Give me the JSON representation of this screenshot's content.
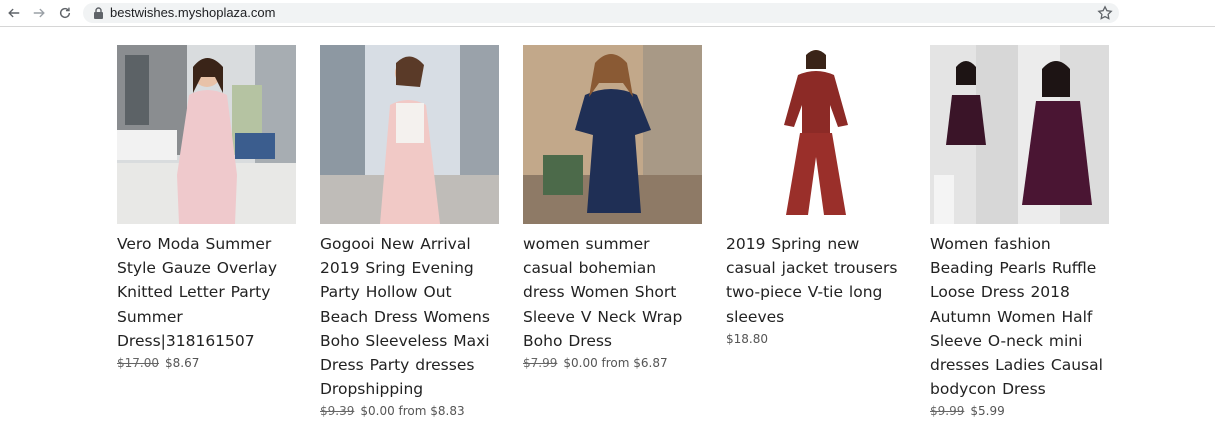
{
  "browser": {
    "url": "bestwishes.myshoplaza.com",
    "icons": [
      "back-arrow-icon",
      "forward-arrow-icon",
      "reload-icon",
      "lock-icon",
      "bookmark-star-icon"
    ]
  },
  "products": [
    {
      "title": "Vero Moda Summer Style Gauze Overlay Knitted Letter Party Summer Dress|318161507",
      "old_price": "$17.00",
      "price": "$8.67"
    },
    {
      "title": "Gogooi New Arrival 2019 Sring Evening Party Hollow Out Beach Dress Womens Boho Sleeveless Maxi Dress Party dresses Dropshipping",
      "old_price": "$9.39",
      "price": "$0.00 from $8.83"
    },
    {
      "title": "women summer casual bohemian dress Women Short Sleeve V Neck Wrap Boho Dress",
      "old_price": "$7.99",
      "price": "$0.00 from $6.87"
    },
    {
      "title": "2019 Spring new casual jacket trousers two-piece V-tie long sleeves",
      "old_price": "",
      "price": "$18.80"
    },
    {
      "title": "Women fashion Beading Pearls Ruffle Loose Dress 2018 Autumn Women Half Sleeve O-neck mini dresses Ladies Causal bodycon Dress",
      "old_price": "$9.99",
      "price": "$5.99"
    }
  ]
}
